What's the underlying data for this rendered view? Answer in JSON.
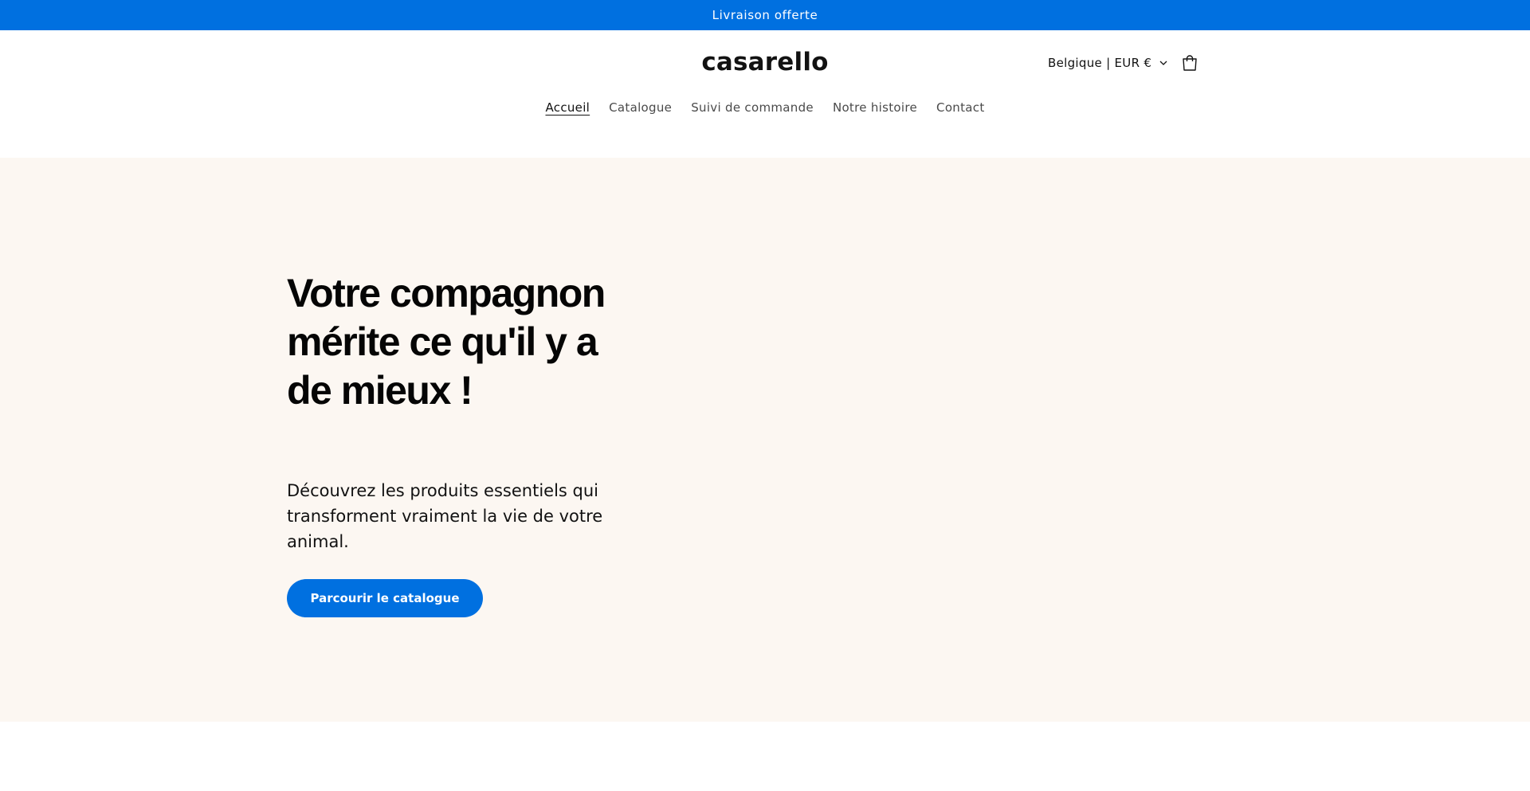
{
  "announcement": {
    "text": "Livraison offerte"
  },
  "header": {
    "logo": "casarello",
    "localization": "Belgique | EUR €",
    "icons": {
      "dropdown": "chevron-down-icon",
      "cart": "cart-icon"
    }
  },
  "nav": {
    "items": [
      {
        "label": "Accueil",
        "active": true
      },
      {
        "label": "Catalogue"
      },
      {
        "label": "Suivi de commande"
      },
      {
        "label": "Notre histoire"
      },
      {
        "label": "Contact"
      }
    ]
  },
  "hero": {
    "title": "Votre compagnon mérite ce qu'il y a de mieux !",
    "text": "Découvrez les produits essentiels qui transforment vraiment la vie de votre animal.",
    "button_label": "Parcourir le catalogue"
  },
  "colors": {
    "accent": "#0070e0",
    "hero_background": "#fcf7f2",
    "text": "#121212"
  }
}
